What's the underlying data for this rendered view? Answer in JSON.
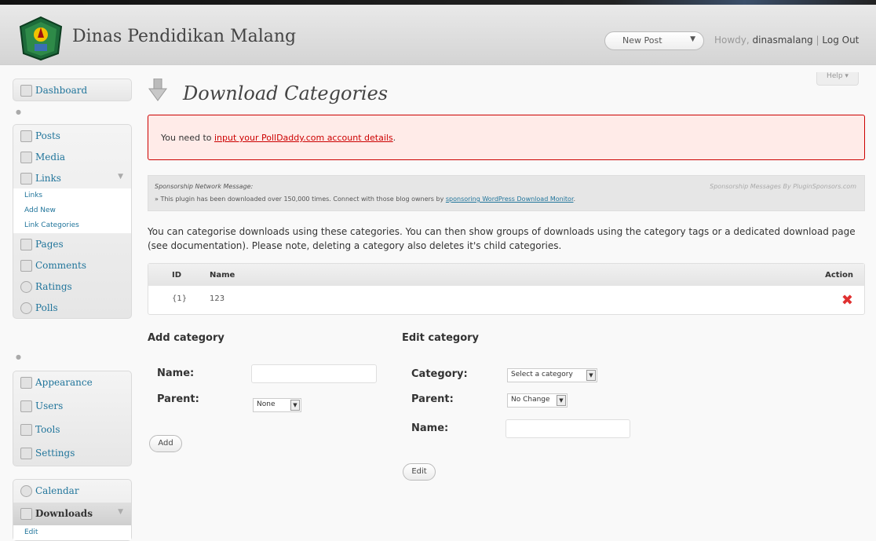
{
  "header": {
    "site_title": "Dinas Pendidikan Malang",
    "new_post": "New Post",
    "howdy": "Howdy,",
    "username": "dinasmalang",
    "logout": "Log Out"
  },
  "sidebar": {
    "dashboard": "Dashboard",
    "posts": "Posts",
    "media": "Media",
    "links": "Links",
    "links_sub": [
      "Links",
      "Add New",
      "Link Categories"
    ],
    "pages": "Pages",
    "comments": "Comments",
    "ratings": "Ratings",
    "polls": "Polls",
    "appearance": "Appearance",
    "users": "Users",
    "tools": "Tools",
    "settings": "Settings",
    "calendar": "Calendar",
    "downloads": "Downloads",
    "downloads_sub": [
      "Edit"
    ]
  },
  "help_tab": "Help ▾",
  "page_title": "Download Categories",
  "error": {
    "prefix": "You need to ",
    "link": "input your PollDaddy.com account details",
    "suffix": "."
  },
  "sponsor": {
    "heading": "Sponsorship Network Message:",
    "right": "Sponsorship Messages By PluginSponsors.com",
    "text": "» This plugin has been downloaded over 150,000 times. Connect with those blog owners by ",
    "link": "sponsoring WordPress Download Monitor",
    "suffix": "."
  },
  "description": "You can categorise downloads using these categories. You can then show groups of downloads using the category tags or a dedicated download page (see documentation). Please note, deleting a category also deletes it's child categories.",
  "table": {
    "headers": {
      "id": "ID",
      "name": "Name",
      "action": "Action"
    },
    "rows": [
      {
        "id": "{1}",
        "name": "123",
        "action": "✖"
      }
    ]
  },
  "add_category": {
    "title": "Add category",
    "name_label": "Name:",
    "parent_label": "Parent:",
    "parent_value": "None",
    "button": "Add"
  },
  "edit_category": {
    "title": "Edit category",
    "category_label": "Category:",
    "category_value": "Select a category",
    "parent_label": "Parent:",
    "parent_value": "No Change",
    "name_label": "Name:",
    "button": "Edit"
  }
}
